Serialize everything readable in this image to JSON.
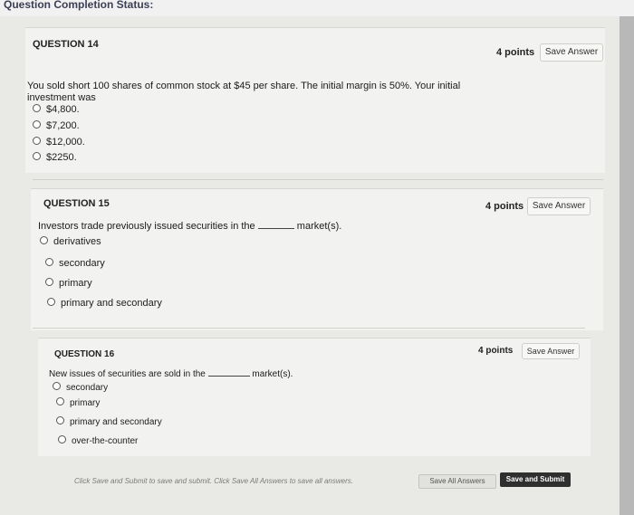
{
  "header": {
    "title": "Question Completion Status:"
  },
  "questions": [
    {
      "title": "QUESTION 14",
      "points": "4 points",
      "save_label": "Save Answer",
      "text_before": "You sold short 100 shares of common stock at $45 per share. The initial margin is 50%. Your initial investment was",
      "text_after": "",
      "options": [
        "$4,800.",
        "$7,200.",
        "$12,000.",
        "$2250."
      ]
    },
    {
      "title": "QUESTION 15",
      "points": "4 points",
      "save_label": "Save Answer",
      "text_before": "Investors trade previously issued securities in the",
      "text_after": "market(s).",
      "options": [
        "derivatives",
        "secondary",
        "primary",
        "primary and secondary"
      ]
    },
    {
      "title": "QUESTION 16",
      "points": "4 points",
      "save_label": "Save Answer",
      "text_before": "New issues of securities are sold in the",
      "text_after": "market(s).",
      "options": [
        "secondary",
        "primary",
        "primary and secondary",
        "over-the-counter"
      ]
    }
  ],
  "footer": {
    "note": "Click Save and Submit to save and submit. Click Save All Answers to save all answers.",
    "save_all_label": "Save All Answers",
    "save_submit_label": "Save and Submit"
  }
}
